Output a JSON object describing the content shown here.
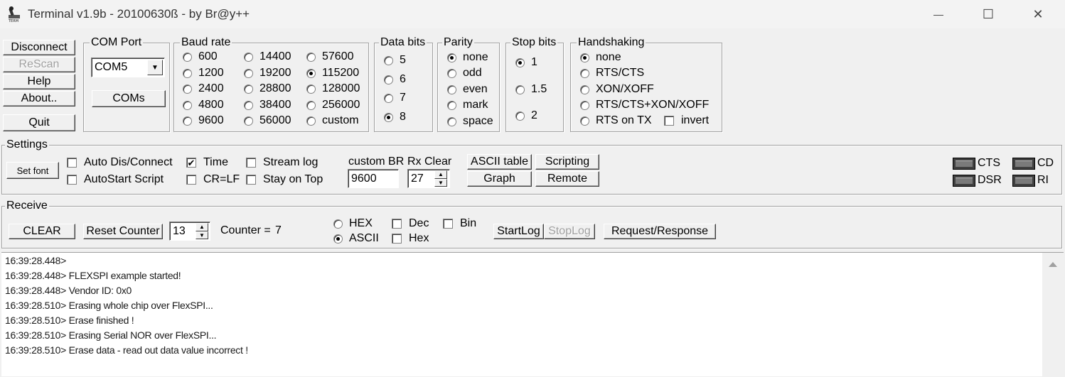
{
  "window": {
    "title": "Terminal v1.9b - 20100630ß - by Br@y++",
    "minimize_glyph": "—",
    "maximize_glyph": "☐",
    "close_glyph": "✕"
  },
  "actions": {
    "disconnect": "Disconnect",
    "rescan": "ReScan",
    "help": "Help",
    "about": "About..",
    "quit": "Quit"
  },
  "com_port": {
    "legend": "COM Port",
    "selected": "COM5",
    "coms_button": "COMs"
  },
  "baud_rate": {
    "legend": "Baud rate",
    "options": [
      "600",
      "1200",
      "2400",
      "4800",
      "9600",
      "14400",
      "19200",
      "28800",
      "38400",
      "56000",
      "57600",
      "115200",
      "128000",
      "256000",
      "custom"
    ],
    "selected": "115200"
  },
  "data_bits": {
    "legend": "Data bits",
    "options": [
      "5",
      "6",
      "7",
      "8"
    ],
    "selected": "8"
  },
  "parity": {
    "legend": "Parity",
    "options": [
      "none",
      "odd",
      "even",
      "mark",
      "space"
    ],
    "selected": "none"
  },
  "stop_bits": {
    "legend": "Stop bits",
    "options": [
      "1",
      "1.5",
      "2"
    ],
    "selected": "1"
  },
  "handshaking": {
    "legend": "Handshaking",
    "options": [
      "none",
      "RTS/CTS",
      "XON/XOFF",
      "RTS/CTS+XON/XOFF",
      "RTS on TX"
    ],
    "selected": "none",
    "invert_label": "invert"
  },
  "settings": {
    "legend": "Settings",
    "set_font": "Set font",
    "auto_dis_connect": "Auto Dis/Connect",
    "autostart_script": "AutoStart Script",
    "time": "Time",
    "time_checked": true,
    "cr_lf": "CR=LF",
    "stream_log": "Stream log",
    "stay_on_top": "Stay on Top",
    "custom_br_label": "custom BR",
    "custom_br_value": "9600",
    "rx_clear_label": "Rx Clear",
    "rx_clear_value": "27",
    "ascii_table": "ASCII table",
    "scripting": "Scripting",
    "graph": "Graph",
    "remote": "Remote",
    "leds": {
      "cts": "CTS",
      "cd": "CD",
      "dsr": "DSR",
      "ri": "RI"
    }
  },
  "receive": {
    "legend": "Receive",
    "clear": "CLEAR",
    "reset_counter": "Reset Counter",
    "counter_spin": "13",
    "counter_label": "Counter =",
    "counter_value": "7",
    "hex": "HEX",
    "ascii": "ASCII",
    "mode_selected": "ASCII",
    "dec": "Dec",
    "hex_check": "Hex",
    "bin": "Bin",
    "start_log": "StartLog",
    "stop_log": "StopLog",
    "request_response": "Request/Response"
  },
  "log_lines": [
    "16:39:28.448>",
    "16:39:28.448> FLEXSPI example started!",
    "16:39:28.448> Vendor ID: 0x0",
    "16:39:28.510> Erasing whole chip over FlexSPI...",
    "16:39:28.510> Erase finished !",
    "16:39:28.510> Erasing Serial NOR over FlexSPI...",
    "16:39:28.510> Erase data -  read out data value incorrect !"
  ]
}
